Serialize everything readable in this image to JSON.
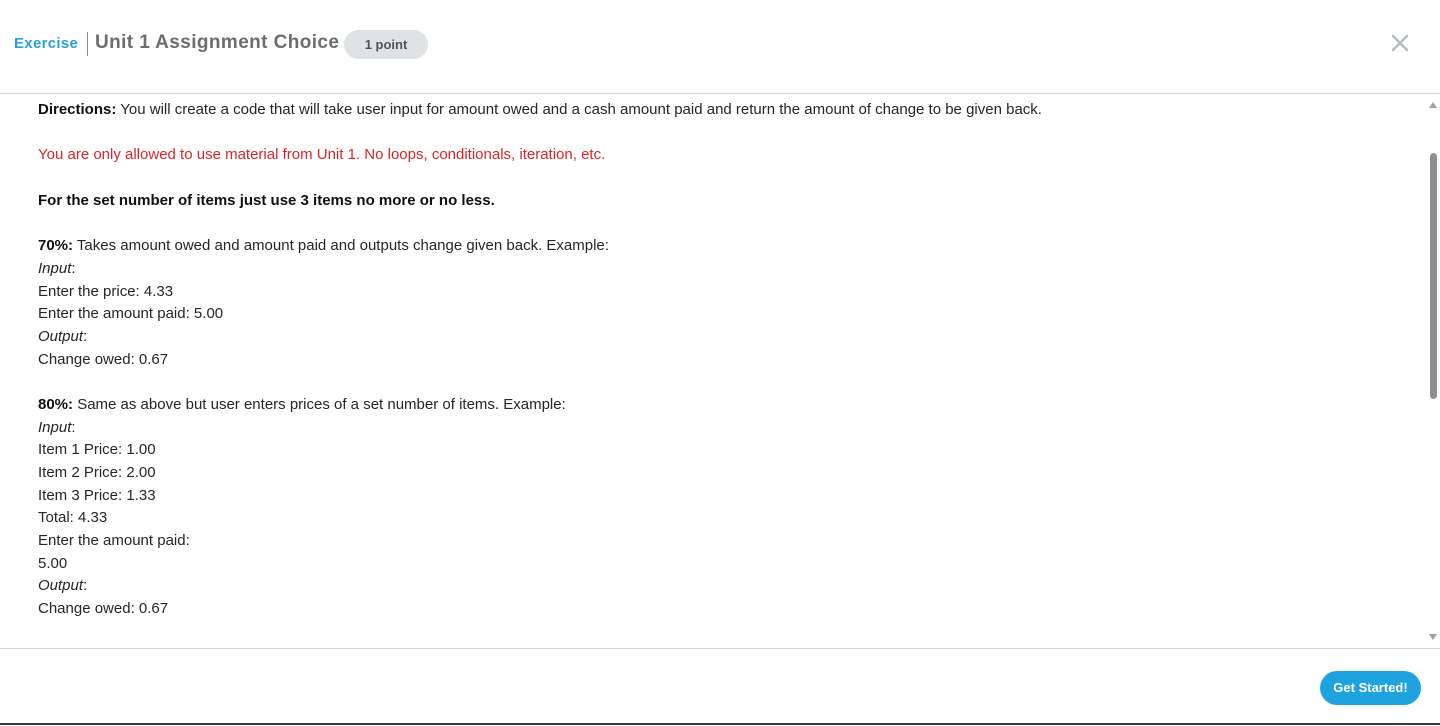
{
  "header": {
    "type_label": "Exercise",
    "title": "Unit 1 Assignment Choice",
    "points": "1 point"
  },
  "content": {
    "directions_label": "Directions:",
    "directions_text": " You will create a code that will take user input for amount owed and a cash amount paid and return the amount of change to be given back.",
    "restriction": "You are only allowed to use material from Unit 1.  No loops, conditionals, iteration, etc.",
    "set_items_note": "For the set number of items just use 3 items no more or no less.",
    "tier70": {
      "label": "70%:",
      "text": " Takes amount owed and amount paid and outputs change given back. Example:",
      "input_label": "Input",
      "input_lines": [
        "Enter the price: 4.33",
        "Enter the amount paid: 5.00"
      ],
      "output_label": "Output",
      "output_lines": [
        "Change owed: 0.67"
      ]
    },
    "tier80": {
      "label": "80%:",
      "text": "  Same as above but user enters prices of a set number of items. Example:",
      "input_label": "Input",
      "input_lines": [
        "Item 1 Price: 1.00",
        "Item 2 Price: 2.00",
        "Item 3 Price: 1.33",
        "Total: 4.33",
        "Enter the amount paid:",
        "5.00"
      ],
      "output_label": "Output",
      "output_lines": [
        "Change owed: 0.67"
      ]
    }
  },
  "footer": {
    "start_label": "Get Started!"
  },
  "colors": {
    "accent": "#2a9fd8",
    "restriction": "#d9262b",
    "button": "#1fa3de",
    "badge": "#dfe3e6"
  },
  "icons": {
    "close": "close-icon",
    "scroll_up": "scroll-up-arrow-icon",
    "scroll_down": "scroll-down-arrow-icon"
  }
}
